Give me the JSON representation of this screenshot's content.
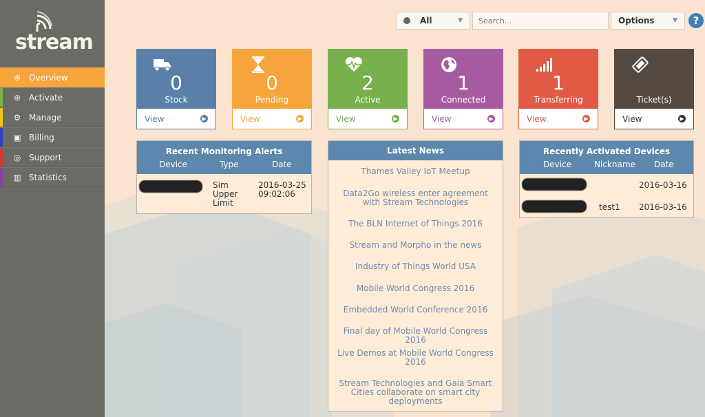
{
  "app": {
    "logo_text": "stream"
  },
  "sidebar": {
    "items": [
      {
        "label": "Overview",
        "icon": "plus-circle-icon",
        "glyph": "⊕",
        "accent": "#f5a53c",
        "active": true
      },
      {
        "label": "Activate",
        "icon": "plus-circle-icon",
        "glyph": "⊕",
        "accent": "#7bb54a",
        "active": false
      },
      {
        "label": "Manage",
        "icon": "gear-icon",
        "glyph": "⚙",
        "accent": "#f1c40f",
        "active": false
      },
      {
        "label": "Billing",
        "icon": "money-icon",
        "glyph": "▣",
        "accent": "#2f3fbf",
        "active": false
      },
      {
        "label": "Support",
        "icon": "lifebuoy-icon",
        "glyph": "◎",
        "accent": "#d03a2f",
        "active": false
      },
      {
        "label": "Statistics",
        "icon": "bar-chart-icon",
        "glyph": "▥",
        "accent": "#8e3fa0",
        "active": false
      }
    ]
  },
  "topbar": {
    "filter_value": "All",
    "search_placeholder": "Search...",
    "options_label": "Options",
    "help_label": "?"
  },
  "tiles": [
    {
      "count": "0",
      "label": "Stock",
      "view": "View",
      "icon": "truck-icon",
      "color": "#5880a8",
      "view_color": "#5880a8"
    },
    {
      "count": "0",
      "label": "Pending",
      "view": "View",
      "icon": "hourglass-icon",
      "color": "#f5a53c",
      "view_color": "#f5a53c"
    },
    {
      "count": "2",
      "label": "Active",
      "view": "View",
      "icon": "heartbeat-icon",
      "color": "#77b04d",
      "view_color": "#77b04d"
    },
    {
      "count": "1",
      "label": "Connected",
      "view": "View",
      "icon": "globe-icon",
      "color": "#a65ba0",
      "view_color": "#a65ba0"
    },
    {
      "count": "1",
      "label": "Transferring",
      "view": "View",
      "icon": "signal-icon",
      "color": "#e15a45",
      "view_color": "#e15a45"
    },
    {
      "count": "",
      "label": "Ticket(s)",
      "view": "View",
      "icon": "ticket-icon",
      "color": "#554a42",
      "view_color": "#333333"
    }
  ],
  "alerts": {
    "title": "Recent Monitoring Alerts",
    "columns": [
      "Device",
      "Type",
      "Date"
    ],
    "rows": [
      {
        "type": "Sim Upper Limit",
        "date": "2016-03-25 09:02:06"
      }
    ]
  },
  "news": {
    "title": "Latest News",
    "items": [
      "Thames Valley IoT Meetup",
      "Data2Go wireless enter agreement with Stream Technologies",
      "The BLN Internet of Things 2016",
      "Stream and Morpho in the news",
      "Industry of Things World USA",
      "Mobile World Congress 2016",
      "Embedded World Conference 2016",
      "Final day of Mobile World Congress 2016",
      "Live Demos at Mobile World Congress 2016",
      "Stream Technologies and Gaia Smart Cities collaborate on smart city deployments"
    ]
  },
  "devices": {
    "title": "Recently Activated Devices",
    "columns": [
      "Device",
      "Nickname",
      "Date"
    ],
    "rows": [
      {
        "nickname": "",
        "date": "2016-03-16"
      },
      {
        "nickname": "test1",
        "date": "2016-03-16"
      }
    ]
  }
}
